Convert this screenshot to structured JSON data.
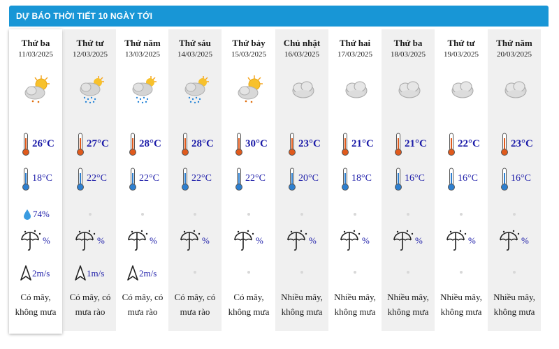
{
  "header": {
    "title": "DỰ BÁO THỜI TIẾT 10 NGÀY TỚI"
  },
  "days": [
    {
      "name": "Thứ ba",
      "date": "11/03/2025",
      "icon": "sun-cloud-icon",
      "high": "26°C",
      "low": "18°C",
      "humidity": "74%",
      "rain": "%",
      "wind": "2m/s",
      "desc": "Có mây, không mưa"
    },
    {
      "name": "Thứ tư",
      "date": "12/03/2025",
      "icon": "sun-cloud-rain-icon",
      "high": "27°C",
      "low": "22°C",
      "humidity": "",
      "rain": "%",
      "wind": "1m/s",
      "desc": "Có mây, có mưa rào"
    },
    {
      "name": "Thứ năm",
      "date": "13/03/2025",
      "icon": "sun-cloud-rain-icon",
      "high": "28°C",
      "low": "22°C",
      "humidity": "",
      "rain": "%",
      "wind": "2m/s",
      "desc": "Có mây, có mưa rào"
    },
    {
      "name": "Thứ sáu",
      "date": "14/03/2025",
      "icon": "sun-cloud-rain-icon",
      "high": "28°C",
      "low": "22°C",
      "humidity": "",
      "rain": "%",
      "wind": "",
      "desc": "Có mây, có mưa rào"
    },
    {
      "name": "Thứ bảy",
      "date": "15/03/2025",
      "icon": "sun-cloud-icon",
      "high": "30°C",
      "low": "22°C",
      "humidity": "",
      "rain": "%",
      "wind": "",
      "desc": "Có mây, không mưa"
    },
    {
      "name": "Chủ nhật",
      "date": "16/03/2025",
      "icon": "cloud-icon",
      "high": "23°C",
      "low": "20°C",
      "humidity": "",
      "rain": "%",
      "wind": "",
      "desc": "Nhiều mây, không mưa"
    },
    {
      "name": "Thứ hai",
      "date": "17/03/2025",
      "icon": "cloud-icon",
      "high": "21°C",
      "low": "18°C",
      "humidity": "",
      "rain": "%",
      "wind": "",
      "desc": "Nhiều mây, không mưa"
    },
    {
      "name": "Thứ ba",
      "date": "18/03/2025",
      "icon": "cloud-icon",
      "high": "21°C",
      "low": "16°C",
      "humidity": "",
      "rain": "%",
      "wind": "",
      "desc": "Nhiều mây, không mưa"
    },
    {
      "name": "Thứ tư",
      "date": "19/03/2025",
      "icon": "cloud-icon",
      "high": "22°C",
      "low": "16°C",
      "humidity": "",
      "rain": "%",
      "wind": "",
      "desc": "Nhiều mây, không mưa"
    },
    {
      "name": "Thứ năm",
      "date": "20/03/2025",
      "icon": "cloud-icon",
      "high": "23°C",
      "low": "16°C",
      "humidity": "",
      "rain": "%",
      "wind": "",
      "desc": "Nhiều mây, không mưa"
    }
  ],
  "colors": {
    "header_bg": "#1896d6",
    "value_text": "#1a1aa8",
    "thermo_high": "#e05a1c",
    "thermo_low": "#2d7fd0",
    "alt_column": "#f0f0f0"
  }
}
